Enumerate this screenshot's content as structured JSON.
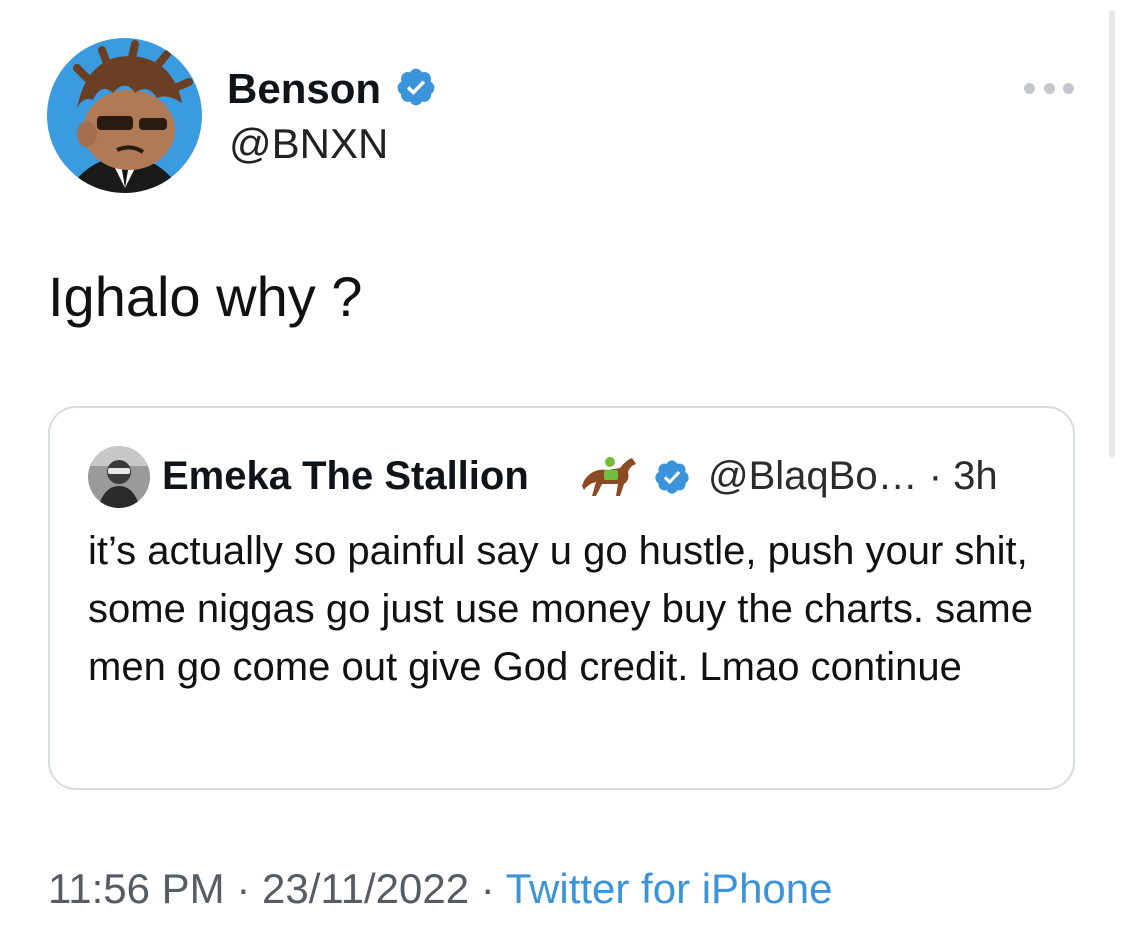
{
  "tweet": {
    "author": {
      "display_name": "Benson",
      "handle": "@BNXN",
      "verified": true,
      "avatar": "cartoon-avatar"
    },
    "text": "Ighalo why ?",
    "quoted": {
      "display_name": "Emeka The Stallion",
      "emoji": "horse-racing-emoji",
      "verified": true,
      "handle": "@BlaqBo…",
      "separator": "·",
      "age": "3h",
      "text": "it’s actually so painful say u go hustle, push your shit, some niggas go just use money buy the charts. same men go come out give God credit. Lmao continue"
    },
    "footer": {
      "time": "11:56 PM",
      "sep1": "·",
      "date": "23/11/2022",
      "sep2": "·",
      "source": "Twitter for iPhone"
    }
  },
  "colors": {
    "verified": "#3b94d9",
    "link": "#3b94d9",
    "avatar_bg": "#3a9be0",
    "card_border": "#d7dce0"
  }
}
